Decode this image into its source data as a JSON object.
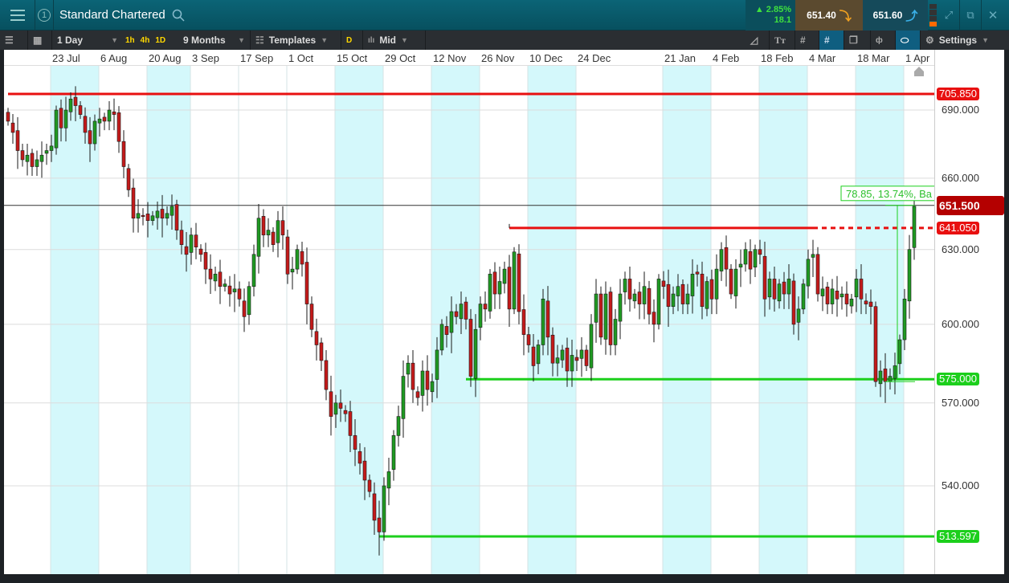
{
  "header": {
    "title": "Standard Chartered",
    "workspace_number": "1",
    "change_pct": "▲ 2.85%",
    "change_abs": "18.1",
    "sell_price": "651.40",
    "buy_price": "651.60"
  },
  "toolbar": {
    "interval": "1 Day",
    "quick_intervals": [
      "1h",
      "4h",
      "1D"
    ],
    "range": "9 Months",
    "templates": "Templates",
    "d_flag": "D",
    "price_type": "Mid",
    "settings": "Settings"
  },
  "colors": {
    "up": "#1f9a22",
    "down": "#c41a1a",
    "resistance": "#e81010",
    "support": "#1ccf1c",
    "band": "#d4f8fb"
  },
  "chart_data": {
    "type": "candlestick",
    "title": "Standard Chartered",
    "scale": "log",
    "x_ticks": [
      {
        "label": "23 Jul",
        "index": 9
      },
      {
        "label": "6 Aug",
        "index": 19
      },
      {
        "label": "20 Aug",
        "index": 29
      },
      {
        "label": "3 Sep",
        "index": 38
      },
      {
        "label": "17 Sep",
        "index": 48
      },
      {
        "label": "1 Oct",
        "index": 58
      },
      {
        "label": "15 Oct",
        "index": 68
      },
      {
        "label": "29 Oct",
        "index": 78
      },
      {
        "label": "12 Nov",
        "index": 88
      },
      {
        "label": "26 Nov",
        "index": 98
      },
      {
        "label": "10 Dec",
        "index": 108
      },
      {
        "label": "24 Dec",
        "index": 118
      },
      {
        "label": "21 Jan",
        "index": 136
      },
      {
        "label": "4 Feb",
        "index": 146
      },
      {
        "label": "18 Feb",
        "index": 156
      },
      {
        "label": "4 Mar",
        "index": 166
      },
      {
        "label": "18 Mar",
        "index": 176
      },
      {
        "label": "1 Apr",
        "index": 186
      }
    ],
    "shaded_bands": [
      [
        0,
        1
      ],
      [
        2,
        3
      ],
      [
        6,
        7
      ],
      [
        8,
        9
      ],
      [
        10,
        11
      ],
      [
        12,
        13
      ],
      [
        14,
        15
      ],
      [
        16,
        17
      ]
    ],
    "y_ticks": [
      "690.000",
      "660.000",
      "630.000",
      "600.000",
      "570.000",
      "540.000"
    ],
    "closes": [
      685,
      680,
      672,
      668,
      670,
      665,
      668,
      670,
      672,
      674,
      690,
      682,
      690,
      695,
      692,
      688,
      680,
      675,
      685,
      686,
      685,
      690,
      688,
      676,
      665,
      655,
      643,
      645,
      644,
      642,
      644,
      646,
      643,
      645,
      648,
      638,
      632,
      628,
      636,
      631,
      628,
      622,
      618,
      620,
      615,
      616,
      612,
      614,
      610,
      603,
      615,
      628,
      643,
      636,
      638,
      632,
      642,
      636,
      620,
      622,
      630,
      624,
      608,
      598,
      592,
      586,
      575,
      565,
      570,
      568,
      566,
      558,
      553,
      548,
      542,
      538,
      528,
      524,
      540,
      545,
      558,
      565,
      580,
      585,
      575,
      572,
      582,
      575,
      578,
      590,
      600,
      596,
      605,
      603,
      608,
      602,
      580,
      598,
      608,
      606,
      620,
      612,
      617,
      622,
      606,
      629,
      605,
      596,
      592,
      584,
      592,
      610,
      595,
      585,
      587,
      590,
      582,
      588,
      586,
      590,
      584,
      600,
      612,
      595,
      612,
      592,
      602,
      612,
      618,
      610,
      612,
      608,
      615,
      604,
      600,
      618,
      615,
      607,
      612,
      615,
      608,
      612,
      620,
      620,
      607,
      617,
      610,
      622,
      630,
      622,
      612,
      622,
      624,
      630,
      622,
      630,
      628,
      610,
      618,
      610,
      616,
      612,
      618,
      600,
      606,
      616,
      626,
      628,
      612,
      614,
      608,
      614,
      610,
      612,
      608,
      610,
      618,
      610,
      608,
      607,
      578,
      582,
      578,
      580,
      584,
      594,
      610,
      630,
      648
    ],
    "levels": [
      {
        "name": "resistance-high",
        "value": 705.85,
        "label": "705.850",
        "color": "#e81010",
        "from_index": 0,
        "style": "solid"
      },
      {
        "name": "resistance-range",
        "value": 641.05,
        "label": "641.050",
        "color": "#e81010",
        "from_index": 104,
        "solid_to_index": 167,
        "style": "solid-then-dashed"
      },
      {
        "name": "support-range",
        "value": 575.0,
        "label": "575.000",
        "color": "#1ccf1c",
        "from_index": 95,
        "style": "solid"
      },
      {
        "name": "support-low",
        "value": 513.597,
        "label": "513.597",
        "color": "#1ccf1c",
        "from_index": 77,
        "style": "solid"
      }
    ],
    "last_price": {
      "value": 651.5,
      "label": "651.500"
    },
    "measure": {
      "from": 575.0,
      "to": 651.5,
      "text": "78.85, 13.74%, Ba"
    }
  }
}
